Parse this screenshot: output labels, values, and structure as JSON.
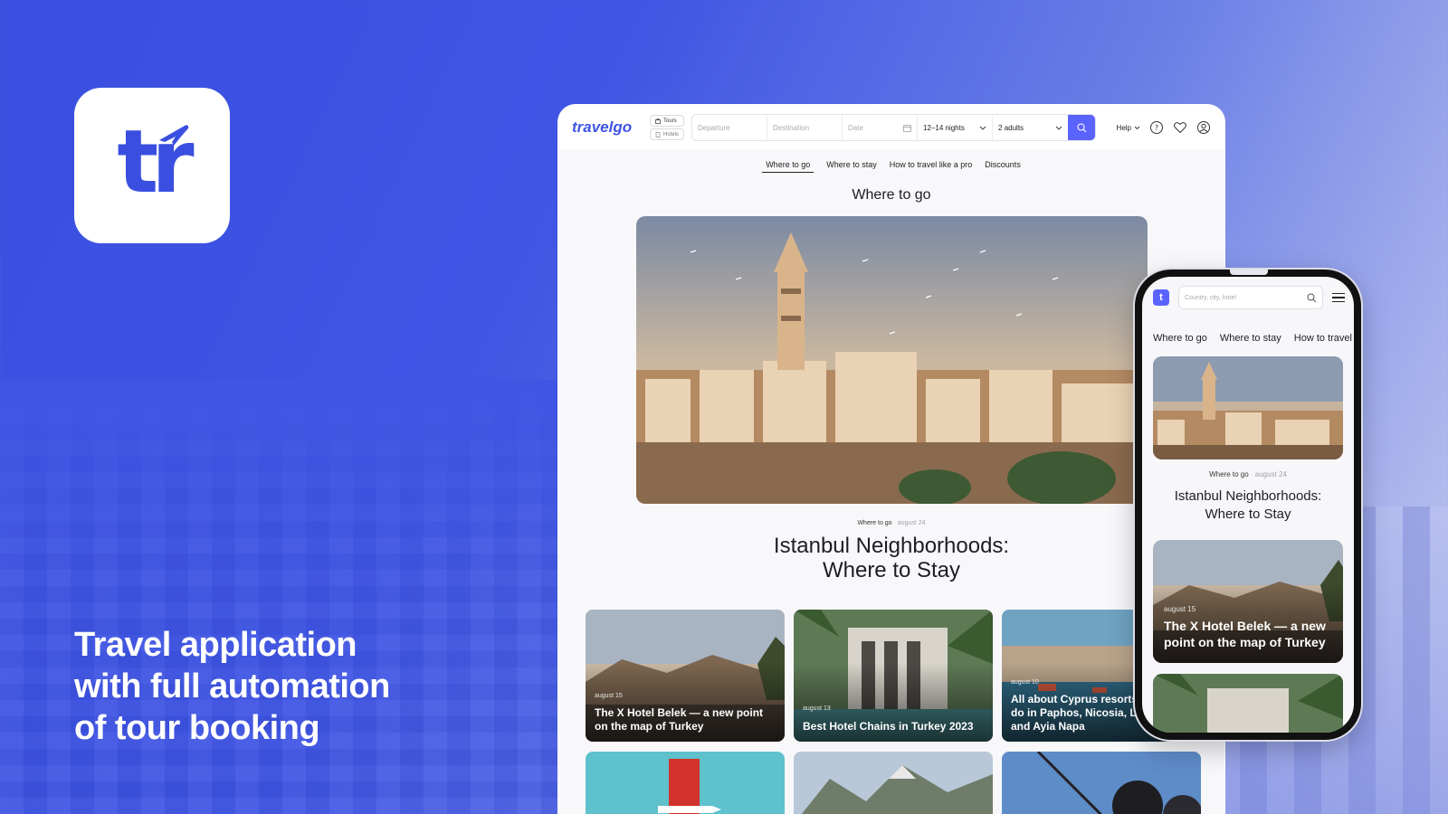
{
  "brand": {
    "app_icon_letters": "tr",
    "accent": "#3f55e4",
    "button_color": "#5b63ff",
    "icon_name": "plane-icon"
  },
  "headline": {
    "line1": "Travel application",
    "line2": "with full automation",
    "line3": "of tour booking"
  },
  "desktop": {
    "logo": "travelgo",
    "type_switch": {
      "tours": "Tours",
      "hotels": "Hotels"
    },
    "search": {
      "departure_placeholder": "Departure",
      "destination_placeholder": "Destination",
      "date_placeholder": "Date",
      "nights": "12–14 nights",
      "guests": "2 adults"
    },
    "help": "Help",
    "nav": [
      "Where to go",
      "Where to stay",
      "How to travel like a pro",
      "Discounts"
    ],
    "section_title": "Where to go",
    "article": {
      "category": "Where to go",
      "date": "august 24",
      "title_line1": "Istanbul Neighborhoods:",
      "title_line2": "Where to Stay"
    },
    "cards": [
      {
        "date": "august 15",
        "title": "The X Hotel Belek — a new point on the map of Turkey"
      },
      {
        "date": "august 13",
        "title": "Best Hotel Chains in Turkey 2023"
      },
      {
        "date": "august 10",
        "title": "All about Cyprus resorts: what to do in Paphos, Nicosia, Larnaca and Ayia Napa"
      }
    ]
  },
  "phone": {
    "logo_letter": "t",
    "search_placeholder": "Country, city, hotel",
    "nav": [
      "Where to go",
      "Where to stay",
      "How to travel like a pro"
    ],
    "article": {
      "category": "Where to go",
      "date": "august 24",
      "title_line1": "Istanbul Neighborhoods:",
      "title_line2": "Where to Stay"
    },
    "card": {
      "date": "august 15",
      "title": "The X Hotel Belek — a new point on the map of Turkey"
    }
  }
}
